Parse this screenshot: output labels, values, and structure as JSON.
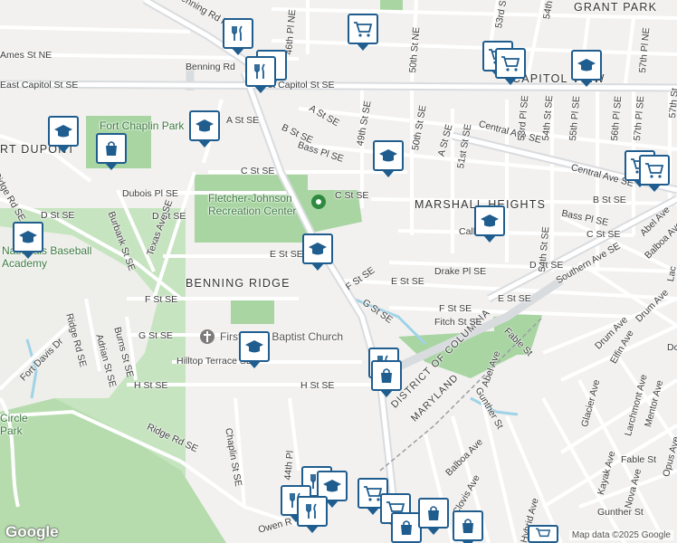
{
  "neighborhoods": {
    "grant_park": "GRANT PARK",
    "capitol_view": "CAPITOL VIEW",
    "fort_dupont": "RT DUPONT",
    "marshall_heights": "MARSHALL HEIGHTS",
    "benning_ridge": "BENNING RIDGE"
  },
  "places": {
    "fletcher_johnson": "Fletcher-Johnson Recreation Center",
    "fort_chaplin": "Fort Chaplin Park",
    "nationals_academy": "Nationals Baseball Academy",
    "first_baptist": "First Rock Baptist Church",
    "circle_park": "Circle Park",
    "dc_border": "DISTRICT OF COLUMBIA",
    "md_border": "MARYLAND"
  },
  "streets": {
    "benning_rd_top": "Benning Rd NE",
    "benning_rd_mid": "Benning Rd",
    "east_capitol": "East Capitol St SE",
    "east_capitol_2": "st Capitol St SE",
    "ames_st": "Ames St NE",
    "a_st": "A St SE",
    "a_st_2": "A St SE",
    "a_st_3": "A St SE",
    "b_st": "B St SE",
    "b_st_2": "B St SE",
    "bass_pl": "Bass Pl SE",
    "bass_pl_2": "Bass Pl SE",
    "c_st": "C St SE",
    "c_st_2": "C St SE",
    "c_st_3": "C St SE",
    "dubois_pl": "Dubois Pl SE",
    "d_st": "D St SE",
    "d_st_2": "D St SE",
    "d_st_3": "D St SE",
    "e_st": "E St SE",
    "e_st_2": "E St SE",
    "e_st_3": "E St SE",
    "f_st": "F St SE",
    "f_st_2": "F St SE",
    "f_st_3": "F St SE",
    "g_st": "G St SE",
    "g_st_2": "G St SE",
    "h_st": "H St SE",
    "h_st_2": "H St SE",
    "call_pl": "Call Pl SE",
    "drake_pl": "Drake Pl SE",
    "fitch_st": "Fitch St SE",
    "hilltop": "Hilltop Terrace SE",
    "central_ave": "Central Ave SE",
    "central_ave_2": "Central Ave SE",
    "southern_ave": "Southern Ave SE",
    "texas_ave": "Texas Ave SE",
    "burbank": "Burbank St SE",
    "ridge_rd": "Ridge Rd SE",
    "ridge_rd_2": "Ridge Rd SE",
    "ridge_rd_3": "Ridge Rd SE",
    "fort_davis": "Fort Davis Dr",
    "burns": "Burns St SE",
    "adrian": "Adrian St SE",
    "chaplin": "Chaplin St SE",
    "st_49": "49th St SE",
    "st_50": "50th St NE",
    "st_50b": "50th St SE",
    "st_51": "51st St SE",
    "st_53": "53rd Pl SE",
    "st_53b": "53rd St",
    "st_54": "54th St SE",
    "st_54b": "54th St SE",
    "st_55": "55th Pl SE",
    "st_56": "56th Pl SE",
    "st_57": "57th Pl SE",
    "st_57b": "57th Pl NE",
    "st_57c": "57th St",
    "st_46": "46th Pl NE",
    "st_44": "44th Pl",
    "st_54t": "54th",
    "abel": "Abel Ave",
    "abel_2": "Abel Ave",
    "balboa": "Balboa Ave",
    "balboa_2": "Balboa Ave",
    "drum": "Drum Ave",
    "drum_2": "Drum Ave",
    "elfin": "Elfin Ave",
    "fable": "Fable St",
    "fable_2": "Fable St",
    "glacier": "Glacier Ave",
    "gunther": "Gunther St",
    "gunther_2": "Gunther St",
    "kayak": "Kayak Ave",
    "larchmont": "Larchmont Ave",
    "mentor": "Mentor Ave",
    "nova": "Nova Ave",
    "opus": "Opus Ave",
    "clovis": "Clovis Ave",
    "hybrid": "Hybrid Ave",
    "lac": "Lac",
    "dc": "Dc",
    "owen": "Owen R"
  },
  "attribution": {
    "logo": "Google",
    "copyright": "Map data ©2025 Google"
  },
  "poi_icons": [
    "restaurant-icon",
    "school-icon",
    "grocery-icon",
    "shopping-bag-icon",
    "church-icon",
    "park-icon"
  ],
  "colors": {
    "background": "#f2f1ef",
    "road": "#ffffff",
    "arterial": "#d9dcdf",
    "park": "#a8d5a2",
    "water": "#9fd3e8",
    "pin_border": "#1f5d8f"
  }
}
